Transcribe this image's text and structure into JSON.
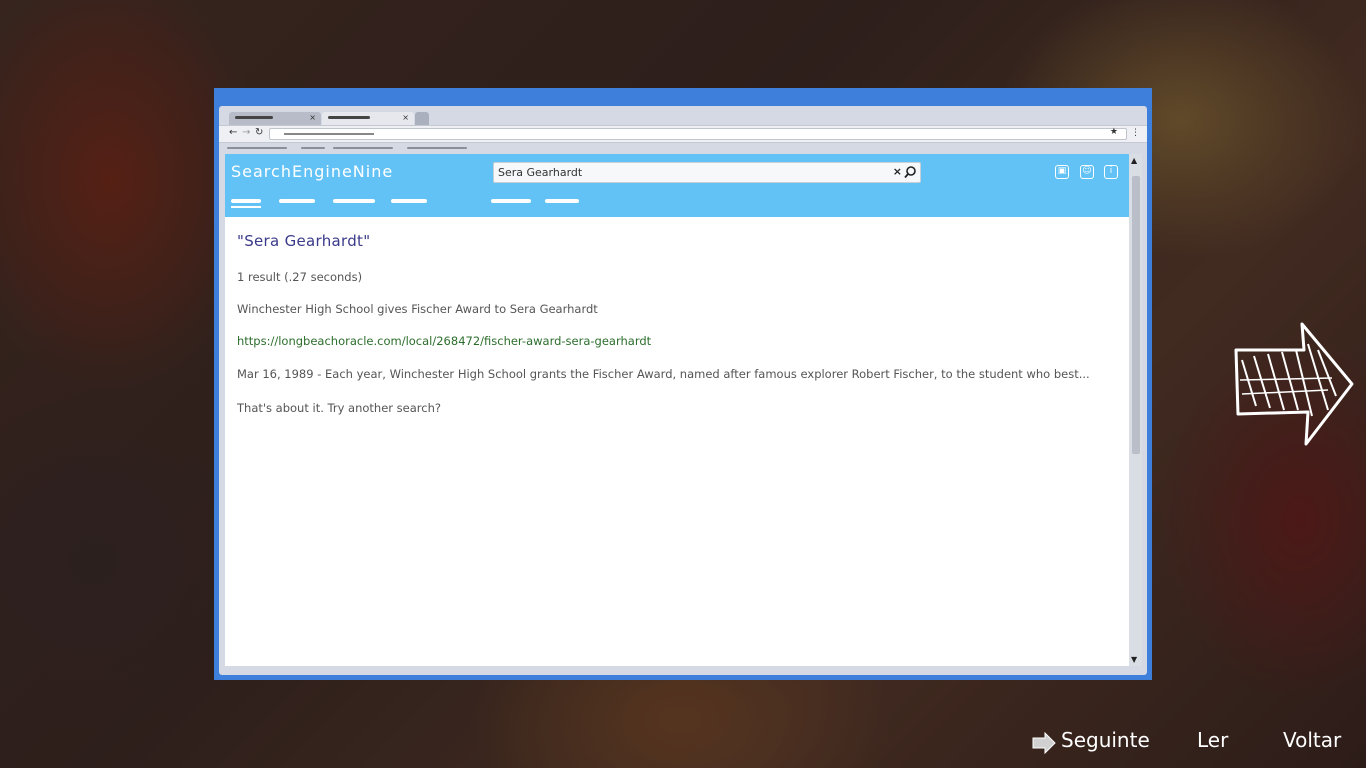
{
  "site": {
    "logo": "SearchEngineNine",
    "search_value": "Sera Gearhardt"
  },
  "results": {
    "query": "\"Sera Gearhardt\"",
    "stats": "1 result (.27 seconds)",
    "items": [
      {
        "title": "Winchester High School gives Fischer Award to Sera Gearhardt",
        "url": "https://longbeachoracle.com/local/268472/fischer-award-sera-gearhardt",
        "snippet": "Mar 16, 1989 - Each year, Winchester High School grants the Fischer Award, named after famous explorer Robert Fischer, to the student who best..."
      }
    ],
    "end_text": "That's about it. Try another search?"
  },
  "bottom_menu": {
    "next_label": "Seguinte",
    "read_label": "Ler",
    "back_label": "Voltar"
  },
  "icons": {
    "clear": "close-icon",
    "search": "search-icon",
    "header": [
      "pages-icon",
      "profile-icon",
      "info-icon"
    ],
    "next": "arrow-right-icon"
  },
  "colors": {
    "window_frame": "#3f7fdc",
    "header_bg": "#62c2f6",
    "query_text": "#3a3a8a",
    "url_text": "#2c6e2c"
  }
}
